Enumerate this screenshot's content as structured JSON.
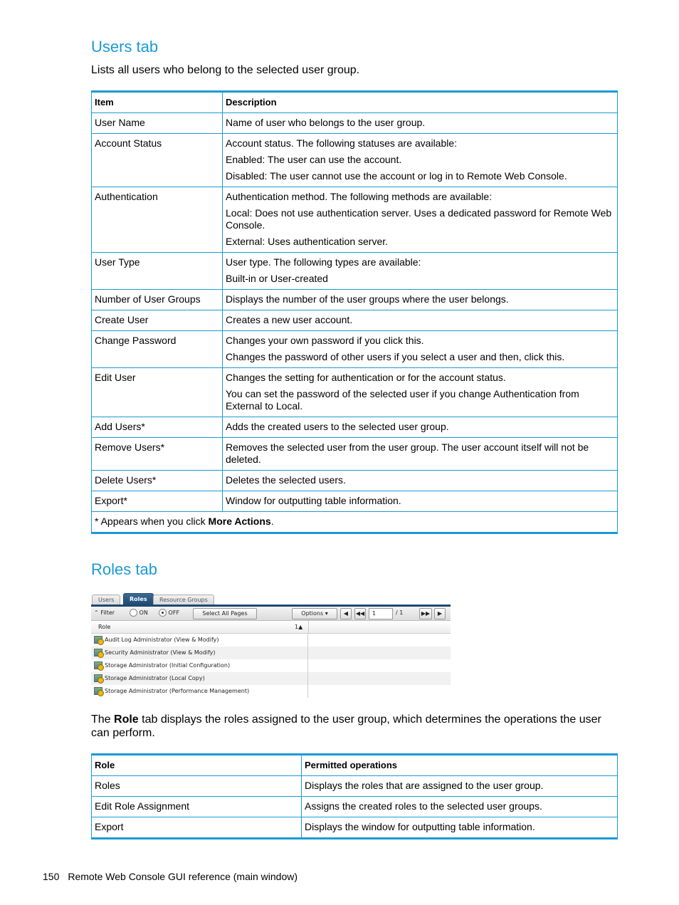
{
  "users_section": {
    "heading": "Users tab",
    "intro": "Lists all users who belong to the selected user group.",
    "table": {
      "headers": [
        "Item",
        "Description"
      ],
      "rows": [
        {
          "item": "User Name",
          "desc": [
            "Name of user who belongs to the user group."
          ]
        },
        {
          "item": "Account Status",
          "desc": [
            "Account status. The following statuses are available:",
            "Enabled: The user can use the account.",
            "Disabled: The user cannot use the account or log in to Remote Web Console."
          ]
        },
        {
          "item": "Authentication",
          "desc": [
            "Authentication method. The following methods are available:",
            "Local: Does not use authentication server. Uses a dedicated password for Remote Web Console.",
            "External: Uses authentication server."
          ]
        },
        {
          "item": "User Type",
          "desc": [
            "User type. The following types are available:",
            "Built-in or User-created"
          ]
        },
        {
          "item": "Number of User Groups",
          "desc": [
            "Displays the number of the user groups where the user belongs."
          ]
        },
        {
          "item": "Create User",
          "desc": [
            "Creates a new user account."
          ]
        },
        {
          "item": "Change Password",
          "desc": [
            "Changes your own password if you click this.",
            "Changes the password of other users if you select a user and then, click this."
          ]
        },
        {
          "item": "Edit User",
          "desc": [
            "Changes the setting for authentication or for the account status.",
            "You can set the password of the selected user if you change Authentication from External to Local."
          ]
        },
        {
          "item": "Add Users*",
          "desc": [
            "Adds the created users to the selected user group."
          ]
        },
        {
          "item": "Remove Users*",
          "desc": [
            "Removes the selected user from the user group. The user account itself will not be deleted."
          ]
        },
        {
          "item": "Delete Users*",
          "desc": [
            "Deletes the selected users."
          ]
        },
        {
          "item": "Export*",
          "desc": [
            "Window for outputting table information."
          ]
        }
      ],
      "footnote_prefix": "* Appears when you click ",
      "footnote_bold": "More Actions",
      "footnote_suffix": "."
    }
  },
  "roles_section": {
    "heading": "Roles tab",
    "screenshot": {
      "tabs": [
        "Users",
        "Roles",
        "Resource Groups"
      ],
      "active_tab": "Roles",
      "toolbar": {
        "filter_label": "Filter",
        "on_label": "ON",
        "off_label": "OFF",
        "select_all_label": "Select All Pages",
        "options_label": "Options",
        "page_current": "1",
        "page_total": "/ 1"
      },
      "column_header": "Role",
      "sort_indicator": "1▲",
      "rows": [
        "Audit Log Administrator (View & Modify)",
        "Security Administrator (View & Modify)",
        "Storage Administrator (Initial Configuration)",
        "Storage Administrator (Local Copy)",
        "Storage Administrator (Performance Management)"
      ]
    },
    "desc_prefix": "The ",
    "desc_bold": "Role",
    "desc_suffix": " tab displays the roles assigned to the user group, which determines the operations the user can perform.",
    "table": {
      "headers": [
        "Role",
        "Permitted operations"
      ],
      "rows": [
        {
          "item": "Roles",
          "desc": "Displays the roles that are assigned to the user group."
        },
        {
          "item": "Edit Role Assignment",
          "desc": "Assigns the created roles to the selected user groups."
        },
        {
          "item": "Export",
          "desc": "Displays the window for outputting table information."
        }
      ]
    }
  },
  "footer": {
    "page_number": "150",
    "title": "Remote Web Console GUI reference (main window)"
  }
}
